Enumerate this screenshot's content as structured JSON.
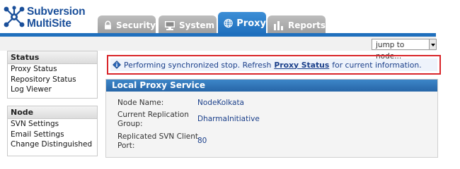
{
  "app": {
    "logo_line1": "Subversion",
    "logo_line2": "MultiSite",
    "logo_icon": "network-hub-icon"
  },
  "tabs": [
    {
      "label": "Security",
      "icon": "lock-icon",
      "active": false
    },
    {
      "label": "System",
      "icon": "monitor-icon",
      "active": false
    },
    {
      "label": "Proxy",
      "icon": "globe-icon",
      "active": true
    },
    {
      "label": "Reports",
      "icon": "bar-chart-icon",
      "active": false
    }
  ],
  "jump": {
    "value": "jump to node..."
  },
  "sidebar": {
    "status": {
      "title": "Status",
      "items": [
        "Proxy Status",
        "Repository Status",
        "Log Viewer"
      ]
    },
    "node": {
      "title": "Node",
      "items": [
        "SVN Settings",
        "Email Settings",
        "Change Distinguished"
      ]
    }
  },
  "message": {
    "icon": "info-diamond-icon",
    "prefix": "Performing synchronized stop. Refresh",
    "link": "Proxy Status",
    "suffix": "for current information."
  },
  "panel": {
    "title": "Local Proxy Service",
    "fields": [
      {
        "label": "Node Name:",
        "value": "NodeKolkata"
      },
      {
        "label_line1": "Current Replication",
        "label_line2": "Group:",
        "value": "DharmaInitiative"
      },
      {
        "label_line1": "Replicated SVN Client",
        "label_line2": "Port:",
        "value": "80"
      }
    ]
  },
  "colors": {
    "brand_blue": "#1f6fbd",
    "alert_border": "#d9252a",
    "link_blue": "#1a3f8a"
  }
}
